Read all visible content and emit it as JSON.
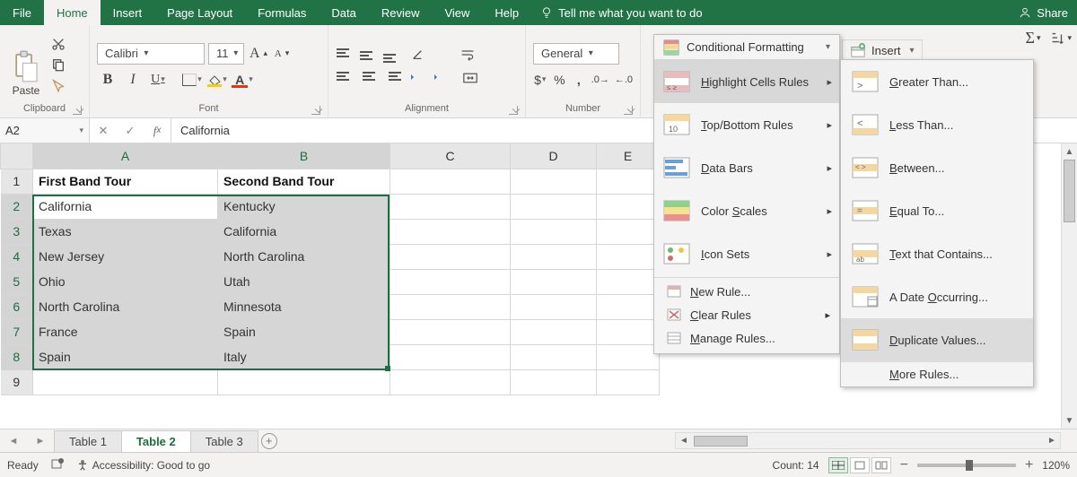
{
  "ribbon": {
    "tabs": [
      "File",
      "Home",
      "Insert",
      "Page Layout",
      "Formulas",
      "Data",
      "Review",
      "View",
      "Help"
    ],
    "active_tab": "Home",
    "tell_me": "Tell me what you want to do",
    "share": "Share"
  },
  "groups": {
    "clipboard": {
      "label": "Clipboard",
      "paste": "Paste"
    },
    "font": {
      "label": "Font",
      "name": "Calibri",
      "size": "11"
    },
    "alignment": {
      "label": "Alignment"
    },
    "number": {
      "label": "Number",
      "format": "General"
    }
  },
  "insert_cells": {
    "label": "Insert"
  },
  "name_box": "A2",
  "formula": "California",
  "columns": [
    "A",
    "B",
    "C",
    "D",
    "E"
  ],
  "row_headers": [
    "1",
    "2",
    "3",
    "4",
    "5",
    "6",
    "7",
    "8",
    "9"
  ],
  "table": {
    "headers": [
      "First Band Tour",
      "Second Band Tour"
    ],
    "rows": [
      [
        "California",
        "Kentucky"
      ],
      [
        "Texas",
        "California"
      ],
      [
        "New Jersey",
        "North Carolina"
      ],
      [
        "Ohio",
        "Utah"
      ],
      [
        "North Carolina",
        "Minnesota"
      ],
      [
        "France",
        "Spain"
      ],
      [
        "Spain",
        "Italy"
      ]
    ]
  },
  "sheet_tabs": [
    "Table 1",
    "Table 2",
    "Table 3"
  ],
  "active_sheet": "Table 2",
  "status": {
    "ready": "Ready",
    "accessibility": "Accessibility: Good to go",
    "count_label": "Count:",
    "count_value": "14",
    "zoom": "120%"
  },
  "cf_menu": {
    "button": "Conditional Formatting",
    "items": [
      {
        "label": "Highlight Cells Rules",
        "u": "H",
        "rest": "ighlight Cells Rules"
      },
      {
        "label": "Top/Bottom Rules",
        "u": "T",
        "rest": "op/Bottom Rules"
      },
      {
        "label": "Data Bars",
        "u": "D",
        "rest": "ata Bars"
      },
      {
        "label": "Color Scales",
        "u": "C",
        "pre": "",
        "post": "olor ",
        "u2": "S",
        "rest": "cales"
      },
      {
        "label": "Icon Sets",
        "u": "I",
        "rest": "con Sets"
      }
    ],
    "small": [
      {
        "u": "N",
        "rest": "ew Rule..."
      },
      {
        "u": "C",
        "rest": "lear Rules"
      },
      {
        "u": "M",
        "pre": "",
        "rest": "anage Rules..."
      }
    ]
  },
  "sub_menu": {
    "items": [
      {
        "u": "G",
        "rest": "reater Than..."
      },
      {
        "u": "L",
        "rest": "ess Than..."
      },
      {
        "u": "B",
        "rest": "etween..."
      },
      {
        "u": "E",
        "rest": "qual To..."
      },
      {
        "u": "T",
        "rest": "ext that Contains..."
      },
      {
        "pre": "A Date ",
        "u": "O",
        "rest": "ccurring..."
      },
      {
        "u": "D",
        "rest": "uplicate Values..."
      }
    ],
    "more": "More Rules..."
  }
}
